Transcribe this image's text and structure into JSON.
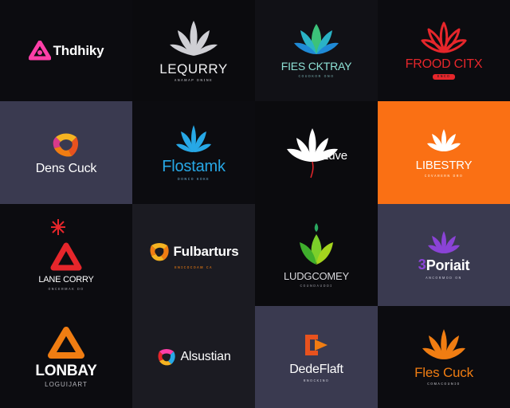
{
  "colors": {
    "tile_dark": "#0c0c10",
    "tile_slate": "#3a3a50",
    "tile_charcoal": "#1b1b22",
    "tile_orange": "#fa7014",
    "pink": "#ff3fa8",
    "blue": "#27a8e6",
    "red": "#e6262b",
    "orange": "#f07d12",
    "purple": "#8a43d6",
    "green": "#4cbf3c"
  },
  "tiles": [
    {
      "name": "Thdhiky",
      "icon": "recycle-icon",
      "tagline": ""
    },
    {
      "name": "LEQURRY",
      "icon": "leaf-icon",
      "tagline": "ᴀɴᴀᴍᴀᴘ ᴅɴɪɴᴇ"
    },
    {
      "name": "FIES CKTRAY",
      "icon": "lotus-icon",
      "tagline": "ᴄᴏᴜᴅᴋᴏʀ ᴏɴᴏ"
    },
    {
      "name": "FROOD CITX",
      "icon": "leaf-icon",
      "tagline": "ᴇɴᴄᴏ"
    },
    {
      "name": "Dens Cuck",
      "icon": "knot-icon",
      "tagline": ""
    },
    {
      "name": "Flostamk",
      "icon": "leaf-icon",
      "tagline": "ᴅᴏɴᴄᴏ ᴋᴏᴋᴇ"
    },
    {
      "name": "Luve",
      "icon": "lotus-icon",
      "tagline": ""
    },
    {
      "name": "LIBESTRY",
      "icon": "leaf-icon",
      "tagline": "ᴄᴏᴠᴀʀᴇʀɴ ᴅʀᴏ"
    },
    {
      "name": "LANE CORRY",
      "icon": "recycle-icon",
      "tagline": "ᴏɴᴄᴇʀᴍᴀᴋ ᴅᴏ"
    },
    {
      "name": "Fulbarturs",
      "icon": "knot-icon",
      "tagline": "ᴇɴɪᴄᴏᴄᴏᴀᴍ ᴄᴀ"
    },
    {
      "name": "LUDGCOMEY",
      "icon": "leaf-icon",
      "tagline": "ᴄᴏᴜɴᴅᴀᴜᴅᴅɪ"
    },
    {
      "name": "Poriait",
      "icon": "lotus-icon",
      "tagline": "ᴀɴᴄᴏʀᴍᴏᴅ ᴏɴ"
    },
    {
      "name": "LONBAY",
      "icon": "recycle-icon",
      "tagline": "LOGUIJART"
    },
    {
      "name": "Alsustian",
      "icon": "knot-icon",
      "tagline": ""
    },
    {
      "name": "DedeFlaft",
      "icon": "arrow-icon",
      "tagline": "ʀɴᴏᴄᴋɪɴᴏ"
    },
    {
      "name": "Fles Cuck",
      "icon": "leaf-icon",
      "tagline": "ᴄᴏᴍᴀᴄᴏᴜɴɪᴏ"
    }
  ]
}
